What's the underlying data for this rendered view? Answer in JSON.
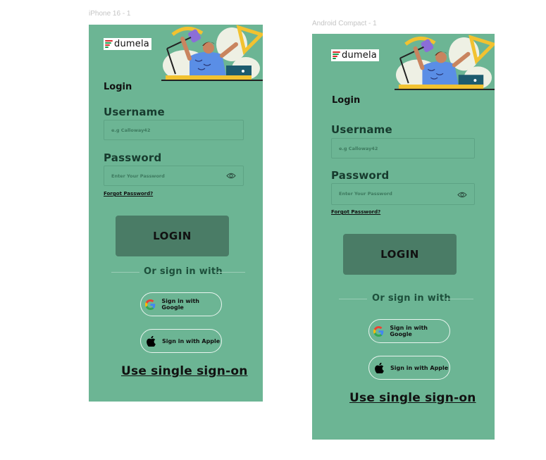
{
  "frames": [
    {
      "label": "iPhone 16 - 1",
      "logo": "dumela",
      "heading": "Login",
      "username_label": "Username",
      "username_placeholder": "e.g Calloway42",
      "password_label": "Password",
      "password_placeholder": "Enter Your Password",
      "forgot": "Forgot Password?",
      "login_button": "LOGIN",
      "or_text": "Or sign in with",
      "google": "Sign in with Google",
      "apple": "Sign in with Apple",
      "sso": "Use single sign-on"
    },
    {
      "label": "Android Compact - 1",
      "logo": "dumela",
      "heading": "Login",
      "username_label": "Username",
      "username_placeholder": "e.g Calloway42",
      "password_label": "Password",
      "password_placeholder": "Enter Your Password",
      "forgot": "Forgot Password?",
      "login_button": "LOGIN",
      "or_text": "Or sign in with",
      "google": "Sign in with Google",
      "apple": "Sign in with Apple",
      "sso": "Use single sign-on"
    }
  ],
  "colors": {
    "frame_bg": "#6cb594",
    "login_button_bg": "#4a7c66",
    "social_border": "#e9f5ef"
  },
  "icons": [
    "dumela-logo-icon",
    "study-illustration",
    "eye-icon",
    "google-icon",
    "apple-icon"
  ]
}
